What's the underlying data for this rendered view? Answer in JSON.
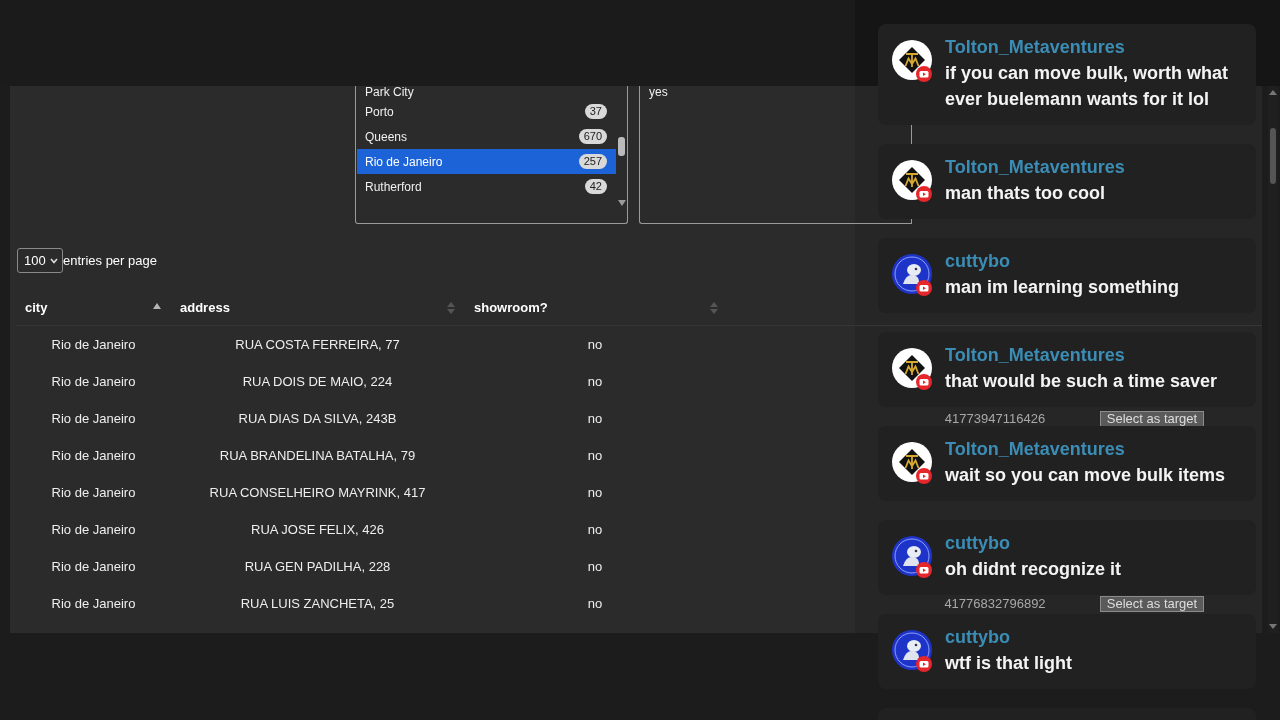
{
  "filters": [
    {
      "kind": "counted",
      "items": [
        {
          "label": "Park City",
          "selected": false
        },
        {
          "label": "Porto",
          "count": "37",
          "selected": false
        },
        {
          "label": "Queens",
          "count": "670",
          "selected": false
        },
        {
          "label": "Rio de Janeiro",
          "count": "257",
          "selected": true
        },
        {
          "label": "Rutherford",
          "count": "42",
          "selected": false
        }
      ]
    },
    {
      "kind": "plain",
      "items": [
        {
          "label": "yes",
          "selected": false
        }
      ]
    }
  ],
  "entries": {
    "value": "100",
    "label": "entries per page"
  },
  "table": {
    "columns": [
      {
        "label": "city",
        "sorted": true
      },
      {
        "label": "address",
        "sorted": false
      },
      {
        "label": "showroom?",
        "sorted": false
      }
    ],
    "rows": [
      {
        "city": "Rio de Janeiro",
        "address": "RUA COSTA FERREIRA, 77",
        "showroom": "no"
      },
      {
        "city": "Rio de Janeiro",
        "address": "RUA DOIS DE MAIO, 224",
        "showroom": "no"
      },
      {
        "city": "Rio de Janeiro",
        "address": "RUA DIAS DA SILVA, 243B",
        "showroom": "no",
        "column_4": "41773947116426",
        "column_5": "Select as target"
      },
      {
        "city": "Rio de Janeiro",
        "address": "RUA BRANDELINA BATALHA, 79",
        "showroom": "no"
      },
      {
        "city": "Rio de Janeiro",
        "address": "RUA CONSELHEIRO MAYRINK, 417",
        "showroom": "no"
      },
      {
        "city": "Rio de Janeiro",
        "address": "RUA JOSE FELIX, 426",
        "showroom": "no"
      },
      {
        "city": "Rio de Janeiro",
        "address": "RUA GEN PADILHA, 228",
        "showroom": "no"
      },
      {
        "city": "Rio de Janeiro",
        "address": "RUA LUIS ZANCHETA, 25",
        "showroom": "no",
        "column_4": "41776832796892",
        "column_5": "Select as target"
      }
    ]
  },
  "chat": {
    "messages": [
      {
        "author": "Tolton_Metaventures",
        "kind": "diamond",
        "text": "if you can move bulk, worth what ever buelemann wants for it lol"
      },
      {
        "author": "Tolton_Metaventures",
        "kind": "diamond",
        "text": "man thats too cool"
      },
      {
        "author": "cuttybo",
        "kind": "figure",
        "text": "man im learning something"
      },
      {
        "author": "Tolton_Metaventures",
        "kind": "diamond",
        "text": "that would be such a time saver"
      },
      {
        "author": "Tolton_Metaventures",
        "kind": "diamond",
        "text": "wait so you can move bulk items"
      },
      {
        "author": "cuttybo",
        "kind": "figure",
        "text": "oh didnt recognize it"
      },
      {
        "author": "cuttybo",
        "kind": "figure",
        "text": "wtf is that light"
      }
    ]
  }
}
